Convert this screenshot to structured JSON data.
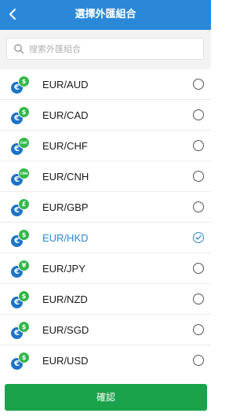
{
  "header": {
    "title": "選擇外匯組合"
  },
  "search": {
    "placeholder": "搜索外匯組合",
    "value": ""
  },
  "list": {
    "items": [
      {
        "pair": "EUR/AUD",
        "quote_symbol": "$",
        "selected": false
      },
      {
        "pair": "EUR/CAD",
        "quote_symbol": "$",
        "selected": false
      },
      {
        "pair": "EUR/CHF",
        "quote_symbol": "CHF",
        "selected": false
      },
      {
        "pair": "EUR/CNH",
        "quote_symbol": "CNH",
        "selected": false
      },
      {
        "pair": "EUR/GBP",
        "quote_symbol": "£",
        "selected": false
      },
      {
        "pair": "EUR/HKD",
        "quote_symbol": "$",
        "selected": true
      },
      {
        "pair": "EUR/JPY",
        "quote_symbol": "¥",
        "selected": false
      },
      {
        "pair": "EUR/NZD",
        "quote_symbol": "$",
        "selected": false
      },
      {
        "pair": "EUR/SGD",
        "quote_symbol": "$",
        "selected": false
      },
      {
        "pair": "EUR/USD",
        "quote_symbol": "$",
        "selected": false
      }
    ],
    "base_symbol": "€"
  },
  "footer": {
    "confirm_label": "確認"
  },
  "colors": {
    "header_bg": "#2b88d9",
    "accent": "#2b88d9",
    "confirm_bg": "#1aa34a",
    "euro_badge": "#1d73c6",
    "quote_badge": "#34b74a"
  },
  "icons": {
    "back": "chevron-left-icon",
    "search": "search-icon",
    "check": "check-icon"
  }
}
